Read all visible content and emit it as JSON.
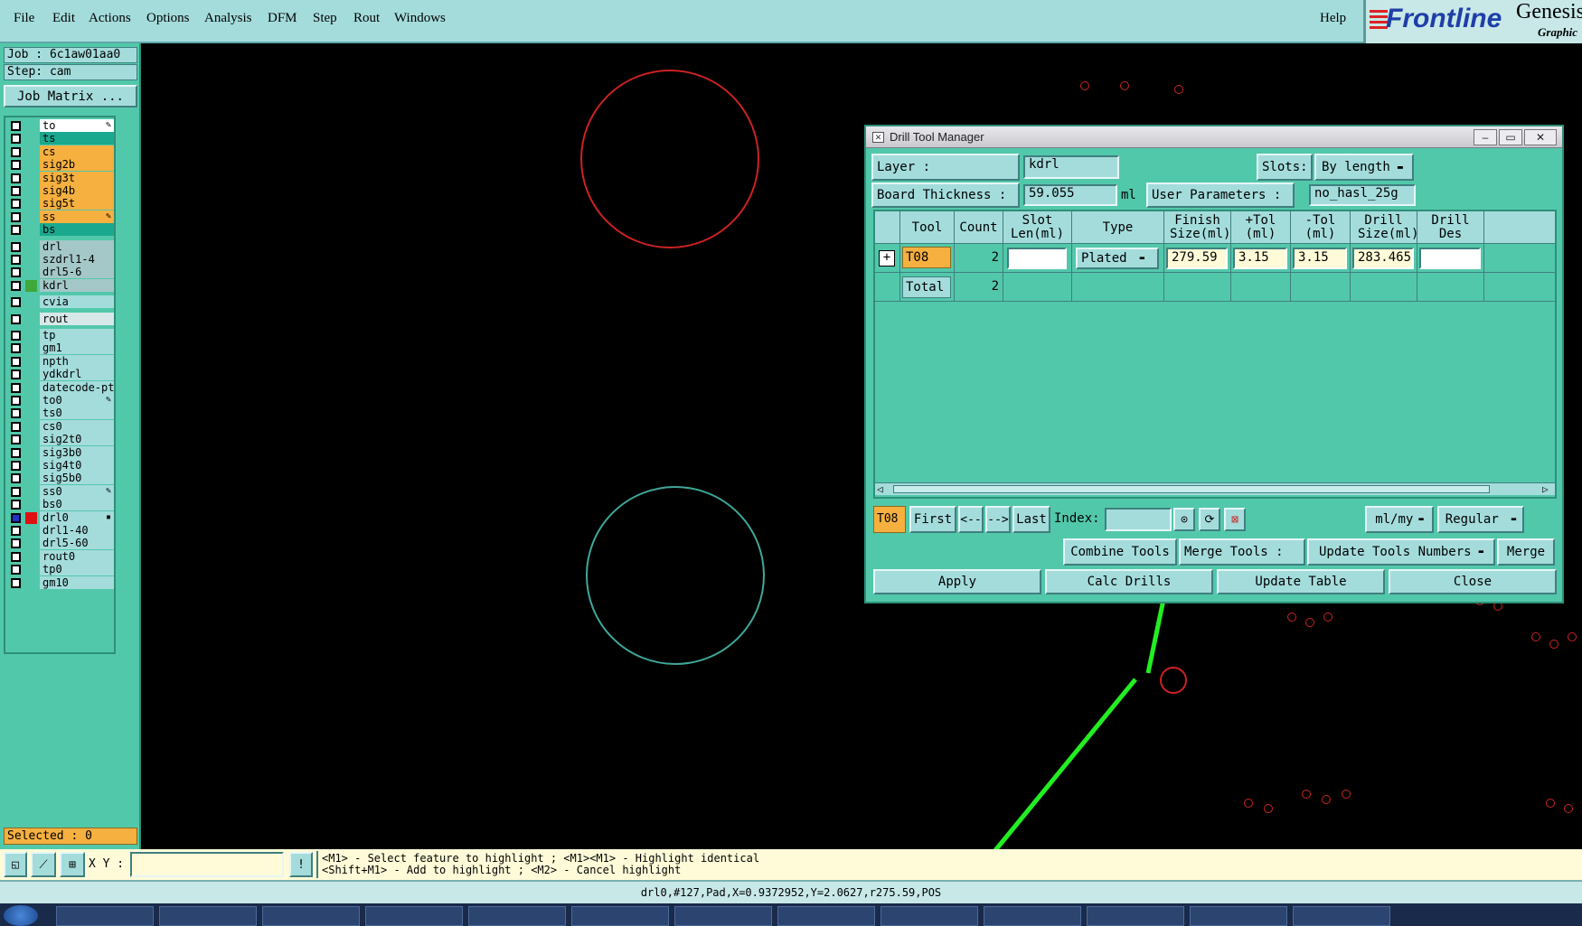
{
  "menubar": {
    "items": [
      "File",
      "Edit",
      "Actions",
      "Options",
      "Analysis",
      "DFM",
      "Step",
      "Rout",
      "Windows"
    ],
    "help": "Help"
  },
  "brand": {
    "logo": "Frontline",
    "name": "Genesis",
    "sub": "Graphic"
  },
  "job": {
    "job_label": "Job : 6c1aw01aa0",
    "step_label": "Step: cam",
    "matrix_button": "Job Matrix ..."
  },
  "layers": [
    {
      "name": "to",
      "color": "#ffffff",
      "mark": "✎"
    },
    {
      "name": "ts",
      "color": "#1aa88e",
      "mark": ""
    },
    {
      "name": "cs",
      "color": "#f5b040",
      "mark": ""
    },
    {
      "name": "sig2b",
      "color": "#f5b040",
      "mark": ""
    },
    {
      "name": "sig3t",
      "color": "#f5b040",
      "mark": ""
    },
    {
      "name": "sig4b",
      "color": "#f5b040",
      "mark": ""
    },
    {
      "name": "sig5t",
      "color": "#f5b040",
      "mark": ""
    },
    {
      "name": "ss",
      "color": "#f5b040",
      "mark": "✎"
    },
    {
      "name": "bs",
      "color": "#1aa88e",
      "mark": ""
    },
    {
      "name": "drl",
      "color": "#a4c8c8",
      "mark": ""
    },
    {
      "name": "szdrl1-4",
      "color": "#a4c8c8",
      "mark": ""
    },
    {
      "name": "drl5-6",
      "color": "#a4c8c8",
      "mark": ""
    },
    {
      "name": "kdrl",
      "color": "#a4c8c8",
      "mark": ""
    },
    {
      "name": "cvia",
      "color": "#a4dcdc",
      "mark": ""
    },
    {
      "name": "rout",
      "color": "#d8e8e8",
      "mark": ""
    },
    {
      "name": "tp",
      "color": "#a4dcdc",
      "mark": ""
    },
    {
      "name": "gm1",
      "color": "#a4dcdc",
      "mark": ""
    },
    {
      "name": "npth",
      "color": "#a4dcdc",
      "mark": ""
    },
    {
      "name": "ydkdrl",
      "color": "#a4dcdc",
      "mark": ""
    },
    {
      "name": "datecode-pt",
      "color": "#a4dcdc",
      "mark": ""
    },
    {
      "name": "to0",
      "color": "#a4dcdc",
      "mark": "✎"
    },
    {
      "name": "ts0",
      "color": "#a4dcdc",
      "mark": ""
    },
    {
      "name": "cs0",
      "color": "#a4dcdc",
      "mark": ""
    },
    {
      "name": "sig2t0",
      "color": "#a4dcdc",
      "mark": ""
    },
    {
      "name": "sig3b0",
      "color": "#a4dcdc",
      "mark": ""
    },
    {
      "name": "sig4t0",
      "color": "#a4dcdc",
      "mark": ""
    },
    {
      "name": "sig5b0",
      "color": "#a4dcdc",
      "mark": ""
    },
    {
      "name": "ss0",
      "color": "#a4dcdc",
      "mark": "✎"
    },
    {
      "name": "bs0",
      "color": "#a4dcdc",
      "mark": ""
    },
    {
      "name": "drl0",
      "color": "#a4dcdc",
      "mark": "▪"
    },
    {
      "name": "drl1-40",
      "color": "#a4dcdc",
      "mark": ""
    },
    {
      "name": "drl5-60",
      "color": "#a4dcdc",
      "mark": ""
    },
    {
      "name": "rout0",
      "color": "#a4dcdc",
      "mark": ""
    },
    {
      "name": "tp0",
      "color": "#a4dcdc",
      "mark": ""
    },
    {
      "name": "gm10",
      "color": "#a4dcdc",
      "mark": ""
    }
  ],
  "selected": "Selected : 0",
  "dialog": {
    "title": "Drill Tool Manager",
    "layer_label": "Layer          :",
    "layer_value": "kdrl",
    "slots_label": "Slots:",
    "slots_value": "By length",
    "thickness_label": "Board Thickness :",
    "thickness_value": "59.055",
    "thickness_unit": "ml",
    "user_params_label": "User Parameters :",
    "user_params_value": "no_hasl_25g",
    "columns": [
      "Tool",
      "Count",
      "Slot Len(ml)",
      "Type",
      "Finish Size(ml)",
      "+Tol (ml)",
      "-Tol (ml)",
      "Drill Size(ml)",
      "Drill Des"
    ],
    "rows": [
      {
        "tool": "T08",
        "count": "2",
        "type": "Plated",
        "finish": "279.59",
        "ptol": "3.15",
        "ntol": "3.15",
        "drill": "283.465"
      }
    ],
    "total_label": "Total",
    "total_count": "2",
    "nav": {
      "current": "T08",
      "first": "First",
      "prev": "<--",
      "next": "-->",
      "last": "Last",
      "index_label": "Index:",
      "units": "ml/my",
      "mode": "Regular"
    },
    "actions": {
      "combine": "Combine Tools",
      "merge_label": "Merge Tools :",
      "update_numbers": "Update Tools Numbers",
      "merge": "Merge"
    },
    "bottom": {
      "apply": "Apply",
      "calc": "Calc Drills",
      "update": "Update Table",
      "close": "Close"
    }
  },
  "status": {
    "xy_label": "X Y :",
    "help_line1": "<M1> - Select feature to highlight ; <M1><M1> - Highlight identical",
    "help_line2": "<Shift+M1> - Add to highlight ; <M2> - Cancel highlight",
    "coords": "drl0,#127,Pad,X=0.9372952,Y=2.0627,r275.59,POS"
  }
}
